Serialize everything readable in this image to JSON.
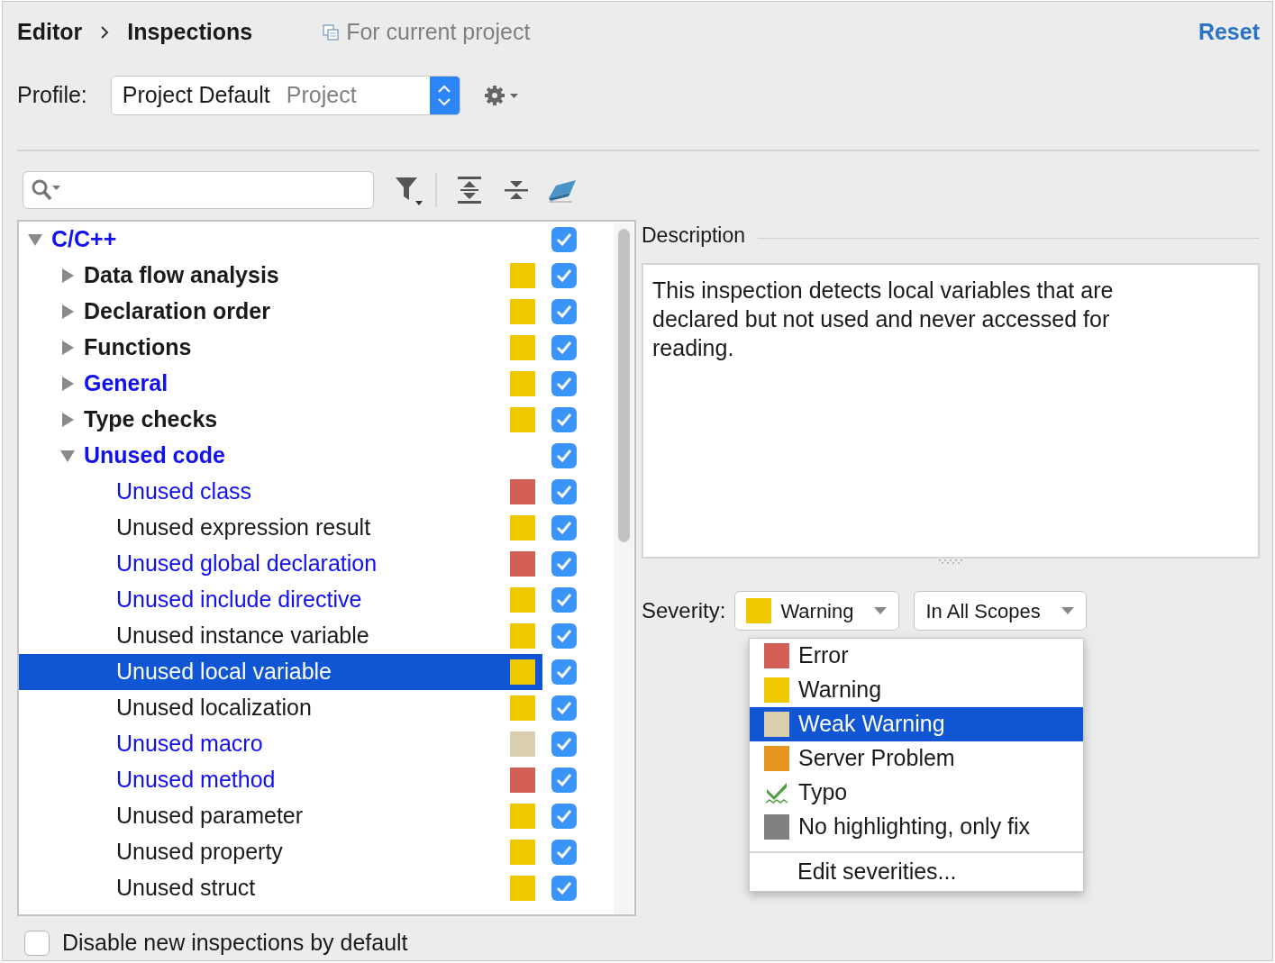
{
  "breadcrumb": [
    "Editor",
    "Inspections"
  ],
  "scope_note": "For current project",
  "reset": "Reset",
  "profile": {
    "label": "Profile:",
    "name": "Project Default",
    "scope": "Project"
  },
  "tree": [
    {
      "label": "C/C++",
      "modified": true,
      "expanded": true,
      "checked": true,
      "selected": false,
      "children": [
        {
          "label": "Data flow analysis",
          "modified": false,
          "expanded": false,
          "checked": true,
          "selected": false,
          "color": "#eec900"
        },
        {
          "label": "Declaration order",
          "modified": false,
          "expanded": false,
          "checked": true,
          "selected": false,
          "color": "#eec900"
        },
        {
          "label": "Functions",
          "modified": false,
          "expanded": false,
          "checked": true,
          "selected": false,
          "color": "#eec900"
        },
        {
          "label": "General",
          "modified": true,
          "expanded": false,
          "checked": true,
          "selected": false,
          "color": "#eec900"
        },
        {
          "label": "Type checks",
          "modified": false,
          "expanded": false,
          "checked": true,
          "selected": false,
          "color": "#eec900"
        },
        {
          "label": "Unused code",
          "modified": true,
          "expanded": true,
          "checked": true,
          "selected": false,
          "children": [
            {
              "label": "Unused class",
              "modified": true,
              "checked": true,
              "selected": false,
              "color": "#d35f56"
            },
            {
              "label": "Unused expression result",
              "modified": false,
              "checked": true,
              "selected": false,
              "color": "#eec900"
            },
            {
              "label": "Unused global declaration",
              "modified": true,
              "checked": true,
              "selected": false,
              "color": "#d35f56"
            },
            {
              "label": "Unused include directive",
              "modified": true,
              "checked": true,
              "selected": false,
              "color": "#eec900"
            },
            {
              "label": "Unused instance variable",
              "modified": false,
              "checked": true,
              "selected": false,
              "color": "#eec900"
            },
            {
              "label": "Unused local variable",
              "modified": false,
              "checked": true,
              "selected": true,
              "color": "#eec900"
            },
            {
              "label": "Unused localization",
              "modified": false,
              "checked": true,
              "selected": false,
              "color": "#eec900"
            },
            {
              "label": "Unused macro",
              "modified": true,
              "checked": true,
              "selected": false,
              "color": "#d9cfae"
            },
            {
              "label": "Unused method",
              "modified": true,
              "checked": true,
              "selected": false,
              "color": "#d35f56"
            },
            {
              "label": "Unused parameter",
              "modified": false,
              "checked": true,
              "selected": false,
              "color": "#eec900"
            },
            {
              "label": "Unused property",
              "modified": false,
              "checked": true,
              "selected": false,
              "color": "#eec900"
            },
            {
              "label": "Unused struct",
              "modified": false,
              "checked": true,
              "selected": false,
              "color": "#eec900"
            }
          ]
        }
      ]
    }
  ],
  "description": {
    "title": "Description",
    "text": "This inspection detects local variables that are declared but not used and never accessed for reading."
  },
  "severity": {
    "label": "Severity:",
    "value": "Warning",
    "color": "#eec900",
    "scope": "In All Scopes"
  },
  "severity_menu": [
    {
      "kind": "swatch",
      "label": "Error",
      "color": "#d35f56",
      "selected": false
    },
    {
      "kind": "swatch",
      "label": "Warning",
      "color": "#eec900",
      "selected": false
    },
    {
      "kind": "swatch",
      "label": "Weak Warning",
      "color": "#d9cfae",
      "selected": true
    },
    {
      "kind": "swatch",
      "label": "Server Problem",
      "color": "#e69520",
      "selected": false
    },
    {
      "kind": "typo",
      "label": "Typo",
      "selected": false
    },
    {
      "kind": "swatch",
      "label": "No highlighting, only fix",
      "color": "#808080",
      "selected": false
    },
    {
      "kind": "action",
      "label": "Edit severities...",
      "selected": false
    }
  ],
  "disable_new": {
    "label": "Disable new inspections by default",
    "checked": false
  }
}
